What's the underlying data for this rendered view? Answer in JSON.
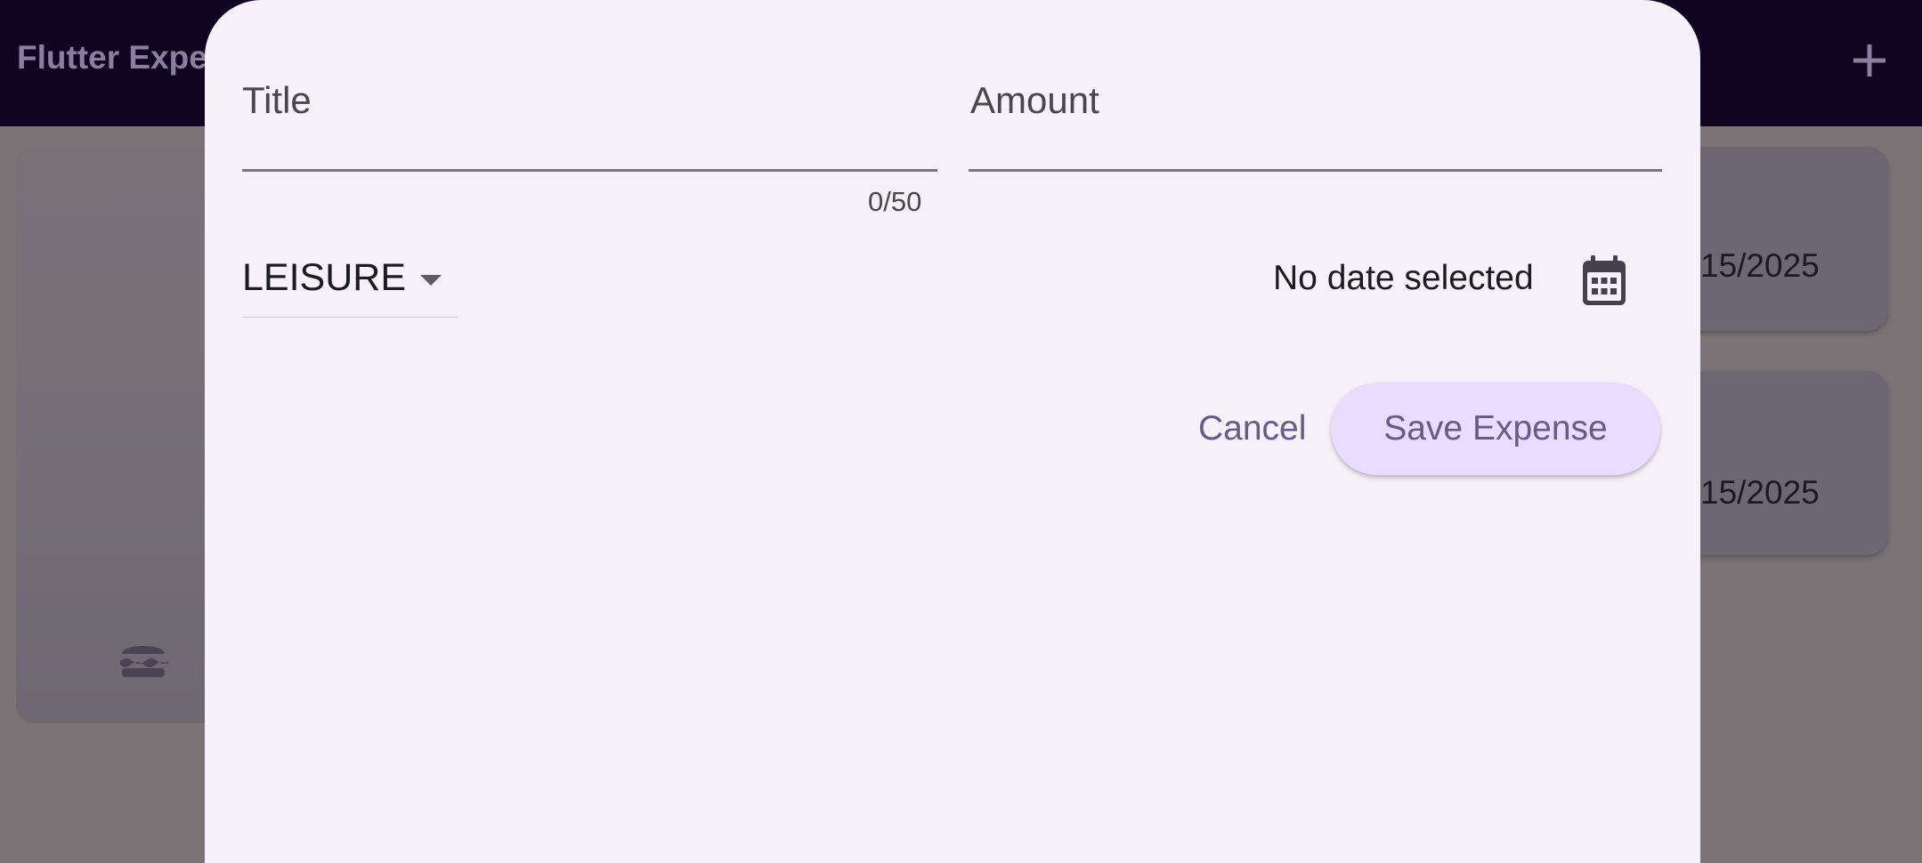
{
  "app": {
    "title": "Flutter Expe",
    "add_icon": "plus-icon"
  },
  "background": {
    "chart_icon": "hamburger-food-icon",
    "expense_dates": [
      "15/2025",
      "15/2025"
    ]
  },
  "form": {
    "title_label": "Title",
    "title_counter": "0/50",
    "amount_label": "Amount",
    "category_value": "LEISURE",
    "date_text": "No date selected",
    "calendar_icon": "calendar-icon",
    "cancel_label": "Cancel",
    "save_label": "Save Expense"
  },
  "colors": {
    "app_bar": "#0f0520",
    "sheet_background": "#f6f1f9",
    "accent_text": "#675a8c",
    "save_button_background": "#e8ddfe"
  }
}
